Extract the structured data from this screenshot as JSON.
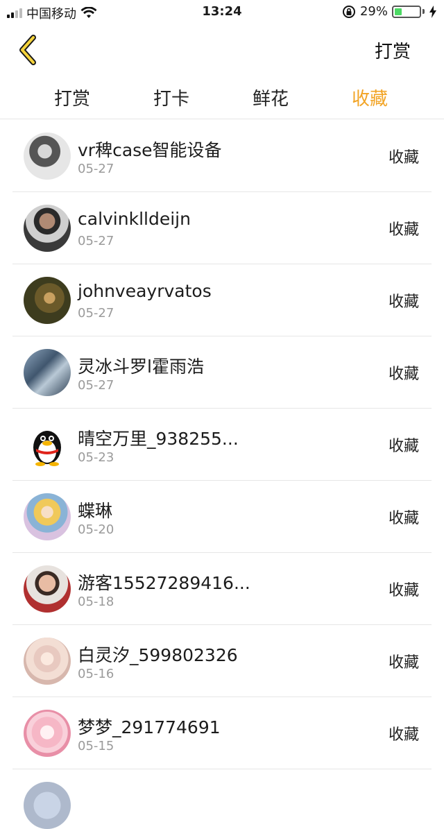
{
  "status_bar": {
    "carrier": "中国移动",
    "time": "13:24",
    "battery": "29%",
    "battery_level": 0.29,
    "icons": [
      "signal-icon",
      "wifi-icon",
      "orientation-lock-icon",
      "battery-icon",
      "charging-icon"
    ]
  },
  "navbar": {
    "back_icon": "chevron-left-icon",
    "action_label": "打赏"
  },
  "tabs": [
    {
      "label": "打赏",
      "active": false
    },
    {
      "label": "打卡",
      "active": false
    },
    {
      "label": "鲜花",
      "active": false
    },
    {
      "label": "收藏",
      "active": true
    }
  ],
  "colors": {
    "accent": "#f2a425",
    "text": "#1a1a1a",
    "secondary_text": "#9a9a9a",
    "divider": "#e6e6e6"
  },
  "list": [
    {
      "name": "vr稗case智能设备",
      "date": "05-27",
      "action": "收藏",
      "avatar": "grayscale-photo-avatar"
    },
    {
      "name": "calvinklldeijn",
      "date": "05-27",
      "action": "收藏",
      "avatar": "man-photo-avatar"
    },
    {
      "name": "johnveayrvatos",
      "date": "05-27",
      "action": "收藏",
      "avatar": "nature-photo-avatar"
    },
    {
      "name": "灵冰斗罗l霍雨浩",
      "date": "05-27",
      "action": "收藏",
      "avatar": "blue-photo-avatar"
    },
    {
      "name": "晴空万里_938255...",
      "date": "05-23",
      "action": "收藏",
      "avatar": "penguin-avatar"
    },
    {
      "name": "蝶琳",
      "date": "05-20",
      "action": "收藏",
      "avatar": "anime-avatar"
    },
    {
      "name": "游客15527289416...",
      "date": "05-18",
      "action": "收藏",
      "avatar": "portrait-avatar"
    },
    {
      "name": "白灵汐_599802326",
      "date": "05-16",
      "action": "收藏",
      "avatar": "anime-pink-avatar"
    },
    {
      "name": "梦梦_291774691",
      "date": "05-15",
      "action": "收藏",
      "avatar": "anime-girl-avatar"
    }
  ]
}
